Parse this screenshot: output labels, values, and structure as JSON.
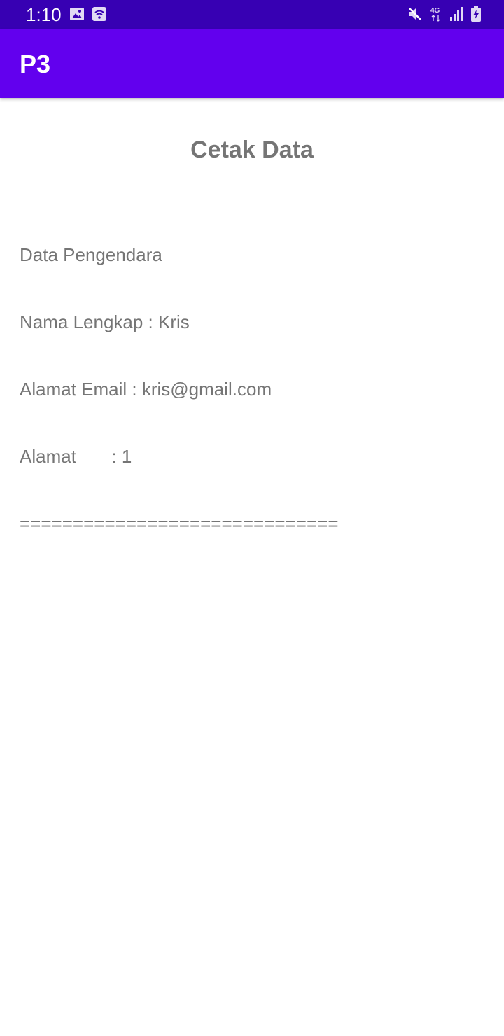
{
  "status_bar": {
    "time": "1:10",
    "left_icons": [
      "image-icon",
      "wifi-notification-icon"
    ],
    "right_icons": [
      "mute-icon",
      "4g-icon",
      "signal-icon",
      "battery-charging-icon"
    ],
    "network_label": "4G",
    "background": "#3700B3"
  },
  "app_bar": {
    "title": "P3",
    "background": "#6200EE"
  },
  "main": {
    "heading": "Cetak Data",
    "lines": [
      "Data Pengendara",
      "Nama Lengkap : Kris",
      "Alamat Email : kris@gmail.com",
      "Alamat       : 1",
      "=============================="
    ]
  }
}
